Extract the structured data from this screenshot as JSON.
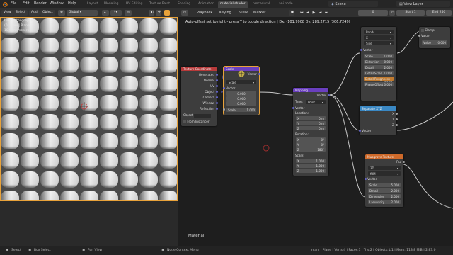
{
  "menu": {
    "file": "File",
    "edit": "Edit",
    "render": "Render",
    "window": "Window",
    "help": "Help"
  },
  "workspace_tabs": [
    "Layout",
    "Modeling",
    "UV Editing",
    "Texture Paint",
    "Shading",
    "Animation",
    "material shader",
    "procedural",
    "ani node"
  ],
  "active_tab": "material shader",
  "scene": "Scene",
  "view_layer": "View Layer",
  "viewport_header": {
    "view": "View",
    "select": "Select",
    "add": "Add",
    "object": "Object",
    "orientation": "Global"
  },
  "viewport_overlay": {
    "line1": "User Orthographic",
    "line2": "(0) mani | Plane",
    "line3": "10 Centimeters"
  },
  "timeline": {
    "playback": "Playback",
    "keying": "Keying",
    "view": "View",
    "marker": "Marker",
    "current_frame": "0",
    "start_label": "Start",
    "start": "1",
    "end_label": "End",
    "end": "250"
  },
  "hint": "Auto-offset set to right - press T to toggle direction  |  Dx: -101.9908  Dy: 289.2715 (306.7249)",
  "material_label": "Material",
  "nodes": {
    "texcoord": {
      "title": "Texture Coordinate",
      "outputs": [
        "Generated",
        "Normal",
        "UV",
        "Object",
        "Camera",
        "Window",
        "Reflection"
      ],
      "object_label": "Object",
      "from_instancer": "From Instancer"
    },
    "scale": {
      "title": "Scale",
      "output": "Vector",
      "mode": "Scale",
      "input_label": "Vector",
      "values": [
        "0.000",
        "0.000",
        "0.000"
      ],
      "scale_label": "Scale",
      "scale_value": "1.000"
    },
    "mapping": {
      "title": "Mapping",
      "output": "Vector",
      "type_label": "Type:",
      "type_value": "Point",
      "vector": "Vector",
      "location": "Location:",
      "loc": [
        {
          "a": "X",
          "v": "0 m"
        },
        {
          "a": "Y",
          "v": "0 m"
        },
        {
          "a": "Z",
          "v": "0 m"
        }
      ],
      "rotation": "Rotation:",
      "rot": [
        {
          "a": "X",
          "v": "0°"
        },
        {
          "a": "Y",
          "v": "0°"
        },
        {
          "a": "Z",
          "v": "180°"
        }
      ],
      "scale": "Scale:",
      "scl": [
        {
          "a": "X",
          "v": "1.000"
        },
        {
          "a": "Y",
          "v": "1.000"
        },
        {
          "a": "Z",
          "v": "1.000"
        }
      ]
    },
    "separate": {
      "title": "Separate XYZ",
      "outputs": [
        "X",
        "Y",
        "Z"
      ],
      "input": "Vector"
    },
    "wave": {
      "type": "Bands",
      "direction": "X",
      "profile": "Sine",
      "vector": "Vector",
      "fields": [
        {
          "label": "Scale",
          "value": "1.000"
        },
        {
          "label": "Distortion",
          "value": "0.000"
        },
        {
          "label": "Detail",
          "value": "2.000"
        },
        {
          "label": "Detail Scale",
          "value": "1.000"
        },
        {
          "label": "Detail Roughness",
          "value": "0.500"
        },
        {
          "label": "Phase Offset",
          "value": "0.000"
        }
      ]
    },
    "clamp": {
      "clamp_label": "Clamp",
      "value_label": "Value",
      "value_field_label": "Value",
      "value_field": "0.000"
    },
    "musgrave": {
      "title": "Musgrave Texture",
      "output": "Fac",
      "dims": "3D",
      "kind": "fBM",
      "vector": "Vector",
      "fields": [
        {
          "label": "Scale",
          "value": "5.000"
        },
        {
          "label": "Detail",
          "value": "2.000"
        },
        {
          "label": "Dimension",
          "value": "2.000"
        },
        {
          "label": "Lacunarity",
          "value": "2.000"
        }
      ]
    }
  },
  "statusbar": {
    "select": "Select",
    "box_select": "Box Select",
    "pan_view": "Pan View",
    "context_menu": "Node Context Menu",
    "stats": "mani | Plane | Verts:4 | Faces:1 | Tris:2 | Objects:1/1 | Mem: 113.8 MiB | 2.83.0"
  },
  "colors": {
    "texcoord_head": "#b83a3a",
    "vector_head": "#6a3fbf",
    "converter_head": "#3a88c4",
    "texture_head": "#cf6a2a",
    "vector_socket": "#6363c7",
    "float_socket": "#a1a1a1",
    "wire": "#c8c8c8",
    "selection": "#e8a23a"
  }
}
